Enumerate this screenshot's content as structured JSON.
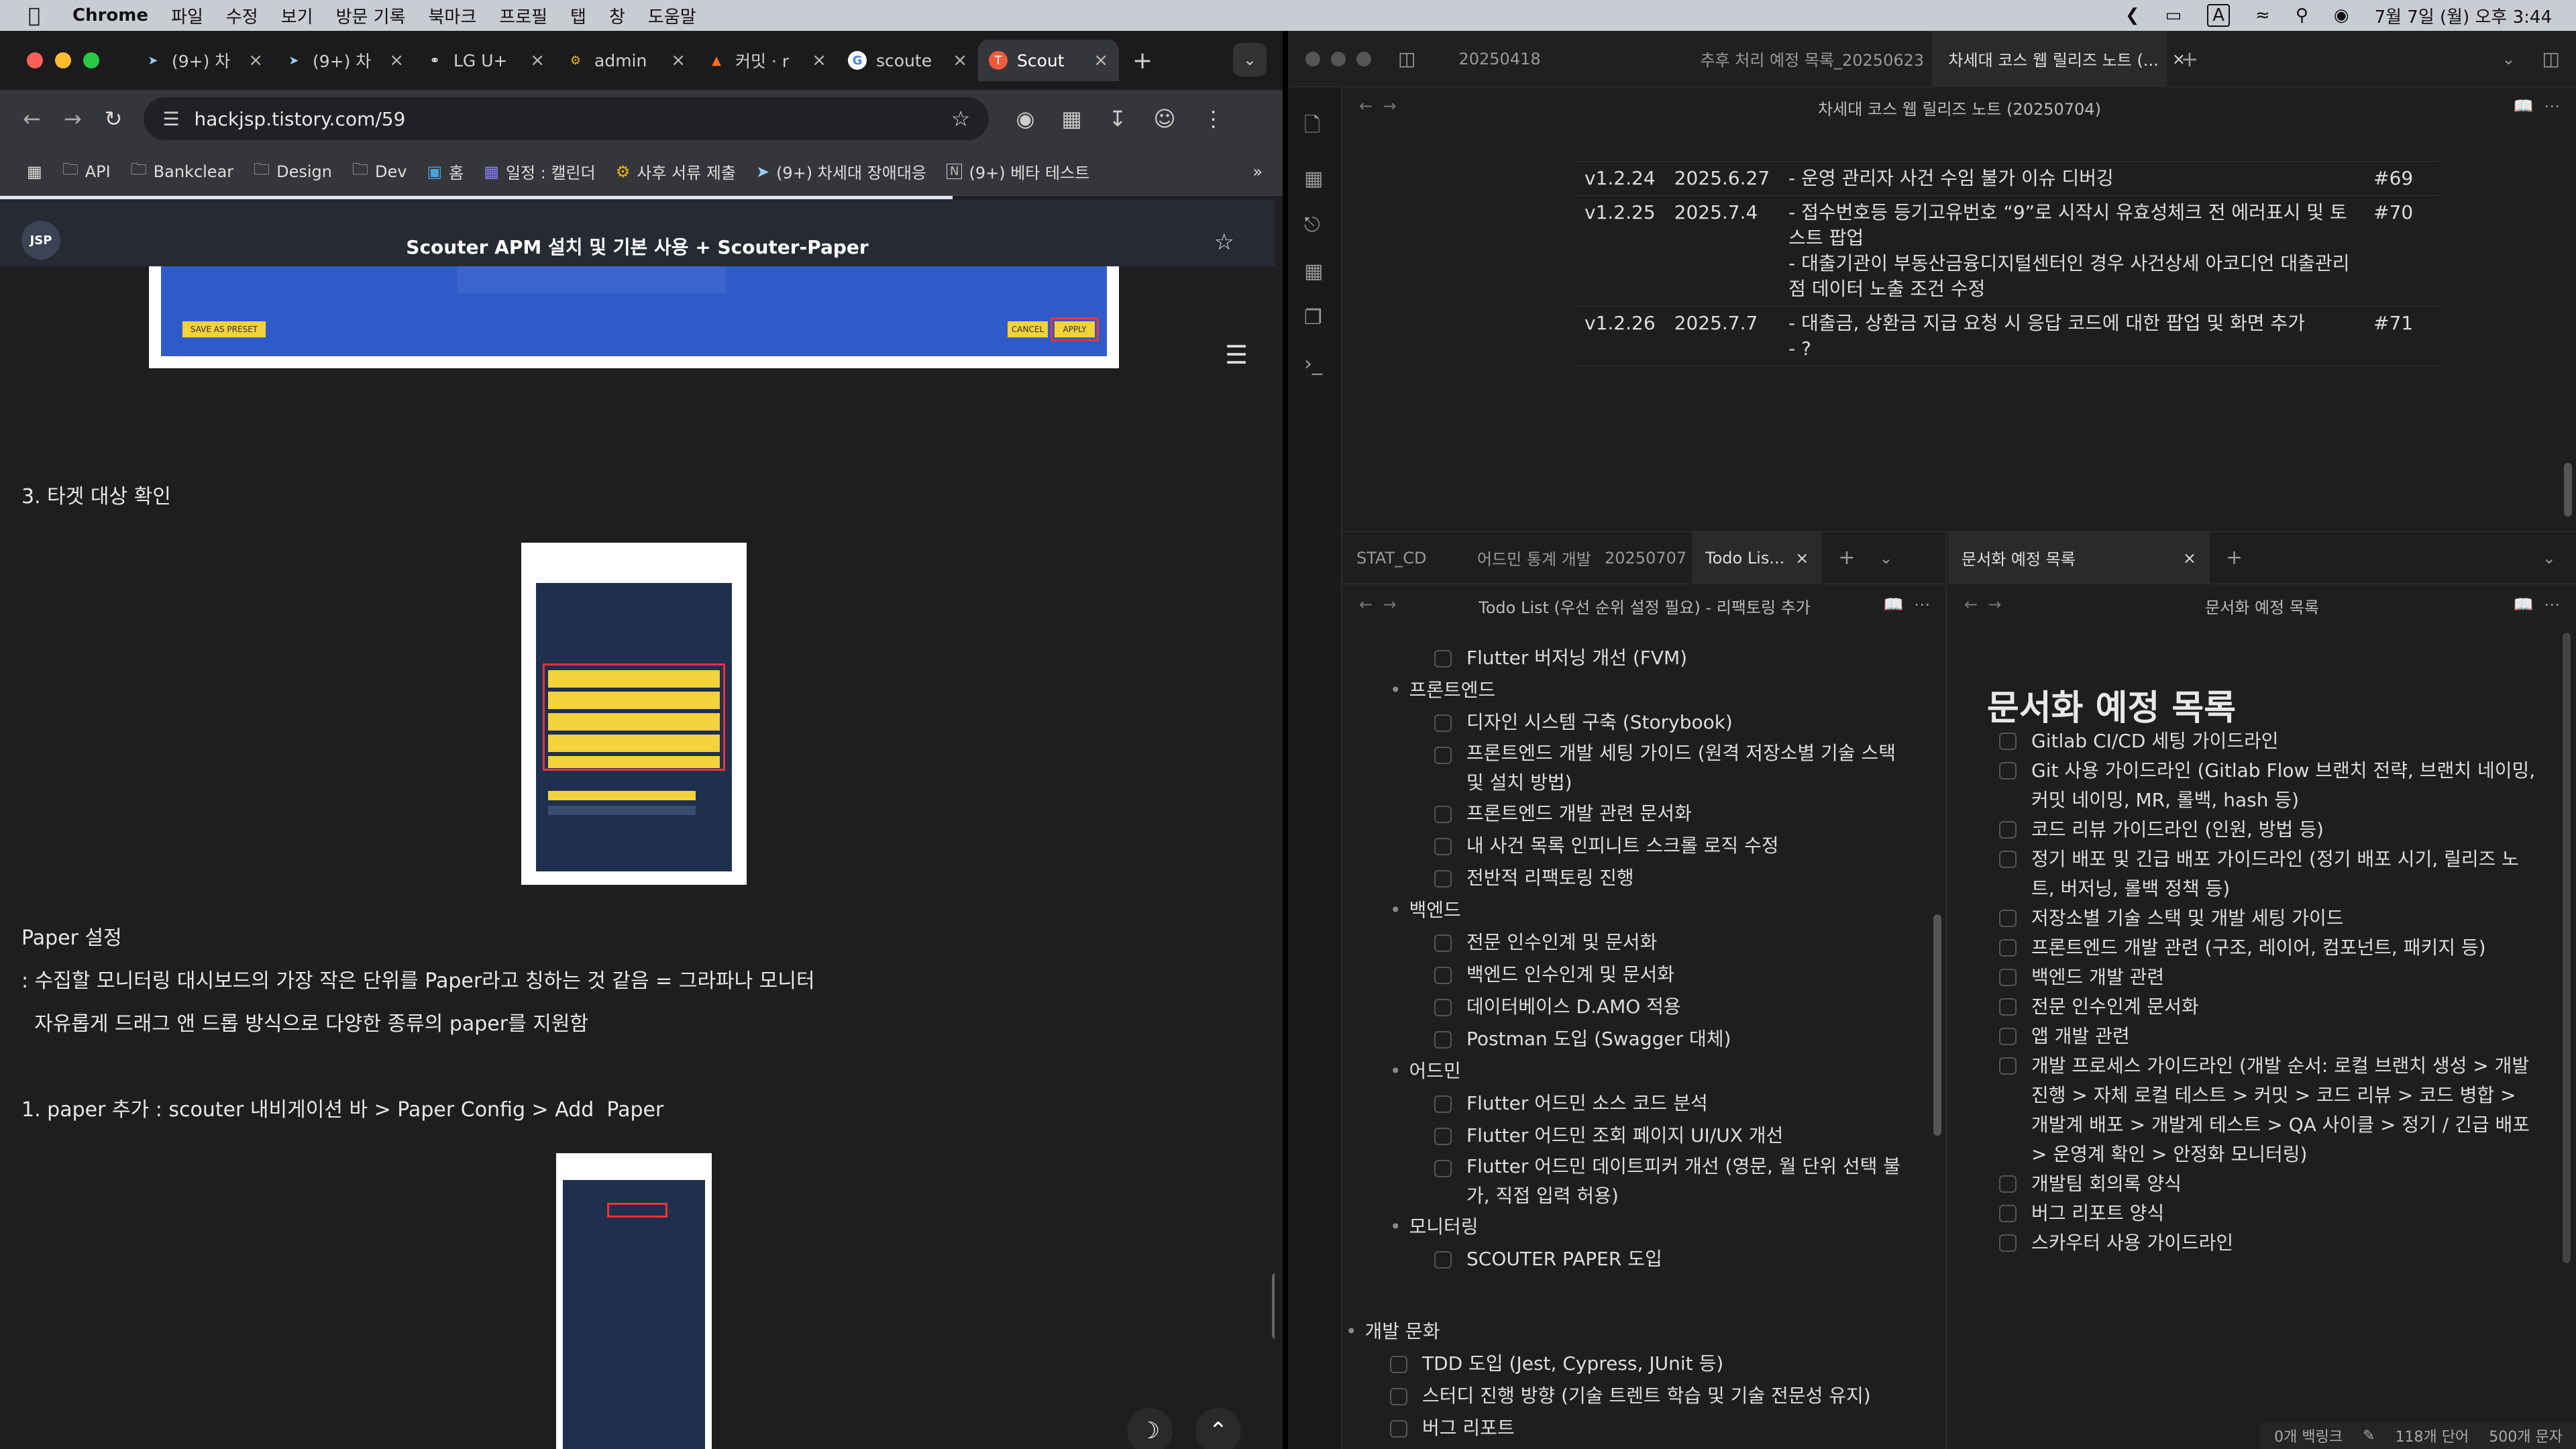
{
  "menubar": {
    "app": "Chrome",
    "items": [
      "파일",
      "수정",
      "보기",
      "방문 기록",
      "북마크",
      "프로필",
      "탭",
      "창",
      "도움말"
    ],
    "input_indicator": "A",
    "datetime": "7월 7일 (월) 오후 3:44"
  },
  "chrome": {
    "tabs": [
      {
        "label": "(9+) 차",
        "icon": "bird-icon"
      },
      {
        "label": "(9+) 차",
        "icon": "bird-icon"
      },
      {
        "label": "LG U+",
        "icon": "globe-icon"
      },
      {
        "label": "admin",
        "icon": "gear-icon"
      },
      {
        "label": "커밋 · r",
        "icon": "gitlab-icon"
      },
      {
        "label": "scoute",
        "icon": "google-icon"
      },
      {
        "label": "Scout",
        "icon": "tistory-icon"
      }
    ],
    "url": "hackjsp.tistory.com/59",
    "bookmarks": [
      "API",
      "Bankclear",
      "Design",
      "Dev",
      "홈",
      "일정 : 캘린더",
      "사후 서류 제출",
      "(9+) 차세대 장애대응",
      "(9+) 베타 테스트"
    ]
  },
  "blog": {
    "logo": "JSP",
    "title": "Scouter APM 설치 및 기본 사용 + Scouter-Paper",
    "section3": "3. 타겟 대상 확인",
    "paper_heading": "Paper 설정",
    "paper_desc1": ": 수집할 모니터링 대시보드의 가장 작은 단위를 Paper라고 칭하는 것 같음 = 그라파나 모니터",
    "paper_desc2": "  자유롭게 드래그 앤 드롭 방식으로 다양한 종류의 paper를 지원함",
    "step1": "1. paper 추가 : scouter 내비게이션 바 > Paper Config > Add  Paper",
    "img_btn1": "SAVE AS PRESET",
    "img_btn2": "CANCEL",
    "img_btn3": "APPLY"
  },
  "obsidian": {
    "top_tabs": [
      "20250418",
      "추후 처리 예정 목록_20250623",
      "차세대 코스 웹 릴리즈 노트 (..."
    ],
    "release_title": "차세대 코스 웹 릴리즈 노트 (20250704)",
    "releases": [
      {
        "ver": "v1.2.24",
        "date": "2025.6.27",
        "desc": "- 운영 관리자 사건 수임 불가 이슈 디버깅",
        "issue": "#69"
      },
      {
        "ver": "v1.2.25",
        "date": "2025.7.4",
        "desc": "- 접수번호등 등기고유번호 “9”로 시작시 유효성체크 전 에러표시 및 토스트 팝업\n- 대출기관이 부동산금융디지털센터인 경우 사건상세 아코디언 대출관리점 데이터 노출 조건 수정",
        "issue": "#70"
      },
      {
        "ver": "v1.2.26",
        "date": "2025.7.7",
        "desc": "- 대출금, 상환금 지급 요청 시 응답 코드에 대한 팝업 및 화면 추가\n- ?",
        "issue": "#71"
      }
    ],
    "mid_tabs": [
      "STAT_CD",
      "어드민 통계 개발",
      "20250707",
      "Todo Lis..."
    ],
    "todo_title": "Todo List (우선 순위 설정 필요) - 리팩토링 추가",
    "todo": {
      "first": "Flutter 버저닝 개선 (FVM)",
      "fe_head": "프론트엔드",
      "fe": [
        "디자인 시스템 구축 (Storybook)",
        "프론트엔드 개발 세팅 가이드 (원격 저장소별 기술 스택 및 설치 방법)",
        "프론트엔드 개발 관련 문서화",
        "내 사건 목록 인피니트 스크롤 로직 수정",
        "전반적 리팩토링 진행"
      ],
      "be_head": "백엔드",
      "be": [
        "전문 인수인계 및 문서화",
        "백엔드 인수인계 및 문서화",
        "데이터베이스 D.AMO 적용",
        "Postman 도입 (Swagger 대체)"
      ],
      "admin_head": "어드민",
      "admin": [
        "Flutter 어드민 소스 코드 분석",
        "Flutter 어드민 조회 페이지 UI/UX 개선",
        "Flutter 어드민 데이트피커 개선 (영문, 월 단위 선택 불가, 직접 입력 허용)"
      ],
      "mon_head": "모니터링",
      "mon": [
        "SCOUTER PAPER 도입"
      ],
      "culture_head": "개발 문화",
      "culture": [
        "TDD 도입 (Jest, Cypress, JUnit 등)",
        "스터디 진행 방향 (기술 트렌트 학습 및 기술 전문성 유지)",
        "버그 리포트"
      ]
    },
    "doc_tab": "문서화 예정 목록",
    "doc_title": "문서화 예정 목록",
    "docs": [
      "Gitlab CI/CD 세팅 가이드라인",
      "Git 사용 가이드라인 (Gitlab Flow 브랜치 전략, 브랜치 네이밍, 커밋 네이밍, MR, 롤백, hash 등)",
      "코드 리뷰 가이드라인 (인원, 방법 등)",
      "정기 배포 및 긴급 배포 가이드라인 (정기 배포 시기, 릴리즈 노트, 버저닝, 롤백 정책 등)",
      "저장소별 기술 스택 및 개발 세팅 가이드",
      "프론트엔드 개발 관련 (구조, 레이어, 컴포넌트, 패키지 등)",
      "백엔드 개발 관련",
      "전문 인수인계 문서화",
      "앱 개발 관련",
      "개발 프로세스 가이드라인 (개발 순서: 로컬 브랜치 생성 > 개발 진행 > 자체 로컬 테스트 > 커밋 > 코드 리뷰 > 코드 병합 > 개발계 배포 > 개발계 테스트 > QA 사이클 > 정기 / 긴급 배포 > 운영계 확인 > 안정화 모니터링)",
      "개발팀 회의록 양식",
      "버그 리포트 양식",
      "스카우터 사용 가이드라인"
    ],
    "status": {
      "backlinks": "0개 백링크",
      "words": "118개 단어",
      "chars": "500개 문자"
    }
  }
}
